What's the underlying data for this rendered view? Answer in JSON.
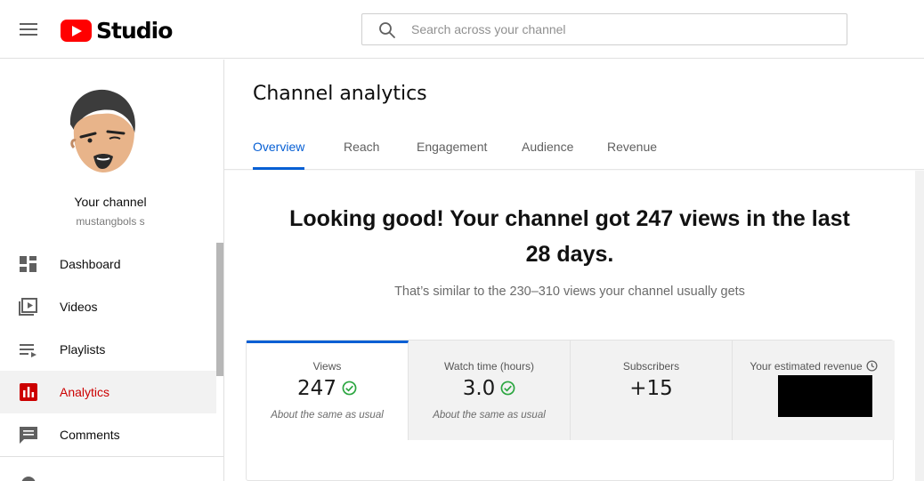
{
  "header": {
    "logo_text": "Studio",
    "search_placeholder": "Search across your channel"
  },
  "sidebar": {
    "channel_title": "Your channel",
    "channel_handle": "mustangbols s",
    "items": [
      {
        "label": "Dashboard",
        "icon": "dashboard-icon",
        "active": false
      },
      {
        "label": "Videos",
        "icon": "videos-icon",
        "active": false
      },
      {
        "label": "Playlists",
        "icon": "playlists-icon",
        "active": false
      },
      {
        "label": "Analytics",
        "icon": "analytics-icon",
        "active": true
      },
      {
        "label": "Comments",
        "icon": "comments-icon",
        "active": false
      }
    ]
  },
  "main": {
    "title": "Channel analytics",
    "tabs": [
      {
        "label": "Overview",
        "active": true
      },
      {
        "label": "Reach",
        "active": false
      },
      {
        "label": "Engagement",
        "active": false
      },
      {
        "label": "Audience",
        "active": false
      },
      {
        "label": "Revenue",
        "active": false
      }
    ],
    "headline": "Looking good! Your channel got 247 views in the last 28 days.",
    "subline": "That’s similar to the 230–310 views your channel usually gets",
    "cards": [
      {
        "label": "Views",
        "value": "247",
        "note": "About the same as usual"
      },
      {
        "label": "Watch time (hours)",
        "value": "3.0",
        "note": "About the same as usual"
      },
      {
        "label": "Subscribers",
        "value": "+15"
      },
      {
        "label": "Your estimated revenue"
      }
    ]
  },
  "colors": {
    "accent": "#065fd4",
    "brand_red": "#ff0000",
    "active_nav": "#cc0000",
    "check_green": "#2ba640"
  }
}
